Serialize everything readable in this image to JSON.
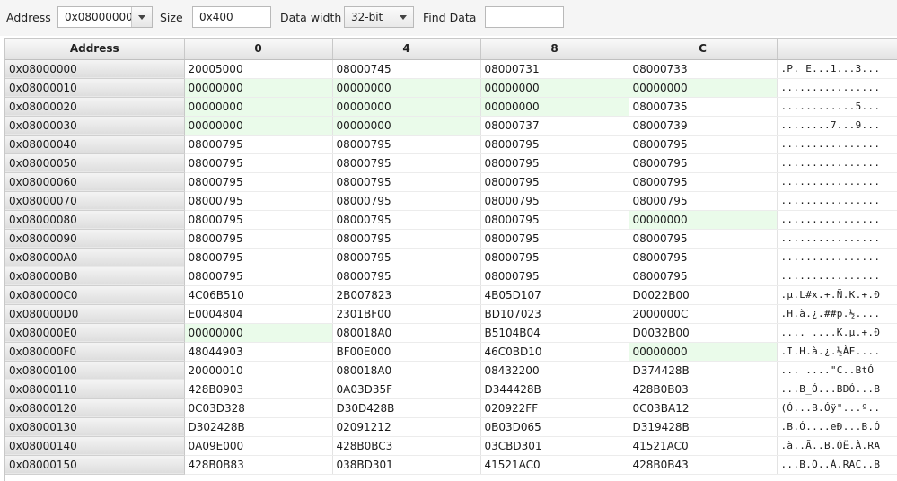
{
  "toolbar": {
    "address_label": "Address",
    "address_value": "0x08000000",
    "size_label": "Size",
    "size_value": "0x400",
    "data_width_label": "Data width",
    "data_width_value": "32-bit",
    "find_label": "Find Data",
    "find_value": ""
  },
  "table": {
    "columns": [
      "Address",
      "0",
      "4",
      "8",
      "C",
      ""
    ],
    "rows": [
      {
        "addr": "0x08000000",
        "c0": "20005000",
        "c4": "08000745",
        "c8": "08000731",
        "cc": "08000733",
        "ascii": ".P. E...1...3..."
      },
      {
        "addr": "0x08000010",
        "c0": "00000000",
        "c4": "00000000",
        "c8": "00000000",
        "cc": "00000000",
        "ascii": "................"
      },
      {
        "addr": "0x08000020",
        "c0": "00000000",
        "c4": "00000000",
        "c8": "00000000",
        "cc": "08000735",
        "ascii": "............5..."
      },
      {
        "addr": "0x08000030",
        "c0": "00000000",
        "c4": "00000000",
        "c8": "08000737",
        "cc": "08000739",
        "ascii": "........7...9..."
      },
      {
        "addr": "0x08000040",
        "c0": "08000795",
        "c4": "08000795",
        "c8": "08000795",
        "cc": "08000795",
        "ascii": "................"
      },
      {
        "addr": "0x08000050",
        "c0": "08000795",
        "c4": "08000795",
        "c8": "08000795",
        "cc": "08000795",
        "ascii": "................"
      },
      {
        "addr": "0x08000060",
        "c0": "08000795",
        "c4": "08000795",
        "c8": "08000795",
        "cc": "08000795",
        "ascii": "................"
      },
      {
        "addr": "0x08000070",
        "c0": "08000795",
        "c4": "08000795",
        "c8": "08000795",
        "cc": "08000795",
        "ascii": "................"
      },
      {
        "addr": "0x08000080",
        "c0": "08000795",
        "c4": "08000795",
        "c8": "08000795",
        "cc": "00000000",
        "ascii": "................"
      },
      {
        "addr": "0x08000090",
        "c0": "08000795",
        "c4": "08000795",
        "c8": "08000795",
        "cc": "08000795",
        "ascii": "................"
      },
      {
        "addr": "0x080000A0",
        "c0": "08000795",
        "c4": "08000795",
        "c8": "08000795",
        "cc": "08000795",
        "ascii": "................"
      },
      {
        "addr": "0x080000B0",
        "c0": "08000795",
        "c4": "08000795",
        "c8": "08000795",
        "cc": "08000795",
        "ascii": "................"
      },
      {
        "addr": "0x080000C0",
        "c0": "4C06B510",
        "c4": "2B007823",
        "c8": "4B05D107",
        "cc": "D0022B00",
        "ascii": ".µ.L#x.+.Ñ.K.+.Ð"
      },
      {
        "addr": "0x080000D0",
        "c0": "E0004804",
        "c4": "2301BF00",
        "c8": "BD107023",
        "cc": "2000000C",
        "ascii": ".H.à.¿.##p.½...."
      },
      {
        "addr": "0x080000E0",
        "c0": "00000000",
        "c4": "080018A0",
        "c8": "B5104B04",
        "cc": "D0032B00",
        "ascii": "....  ....K.µ.+.Ð"
      },
      {
        "addr": "0x080000F0",
        "c0": "48044903",
        "c4": "BF00E000",
        "c8": "46C0BD10",
        "cc": "00000000",
        "ascii": ".I.H.à.¿.½ÀF...."
      },
      {
        "addr": "0x08000100",
        "c0": "20000010",
        "c4": "080018A0",
        "c8": "08432200",
        "cc": "D374428B",
        "ascii": "...   ....\"C..BtÓ"
      },
      {
        "addr": "0x08000110",
        "c0": "428B0903",
        "c4": "0A03D35F",
        "c8": "D344428B",
        "cc": "428B0B03",
        "ascii": "...B_Ó...BDÓ...B"
      },
      {
        "addr": "0x08000120",
        "c0": "0C03D328",
        "c4": "D30D428B",
        "c8": "020922FF",
        "cc": "0C03BA12",
        "ascii": "(Ó...B.Óÿ\"...º.."
      },
      {
        "addr": "0x08000130",
        "c0": "D302428B",
        "c4": "02091212",
        "c8": "0B03D065",
        "cc": "D319428B",
        "ascii": ".B.Ó....eÐ...B.Ó"
      },
      {
        "addr": "0x08000140",
        "c0": "0A09E000",
        "c4": "428B0BC3",
        "c8": "03CBD301",
        "cc": "41521AC0",
        "ascii": ".à..Ã..B.ÓË.À.RA"
      },
      {
        "addr": "0x08000150",
        "c0": "428B0B83",
        "c4": "038BD301",
        "c8": "41521AC0",
        "cc": "428B0B43",
        "ascii": "...B.Ó..À.RAC..B"
      }
    ]
  }
}
